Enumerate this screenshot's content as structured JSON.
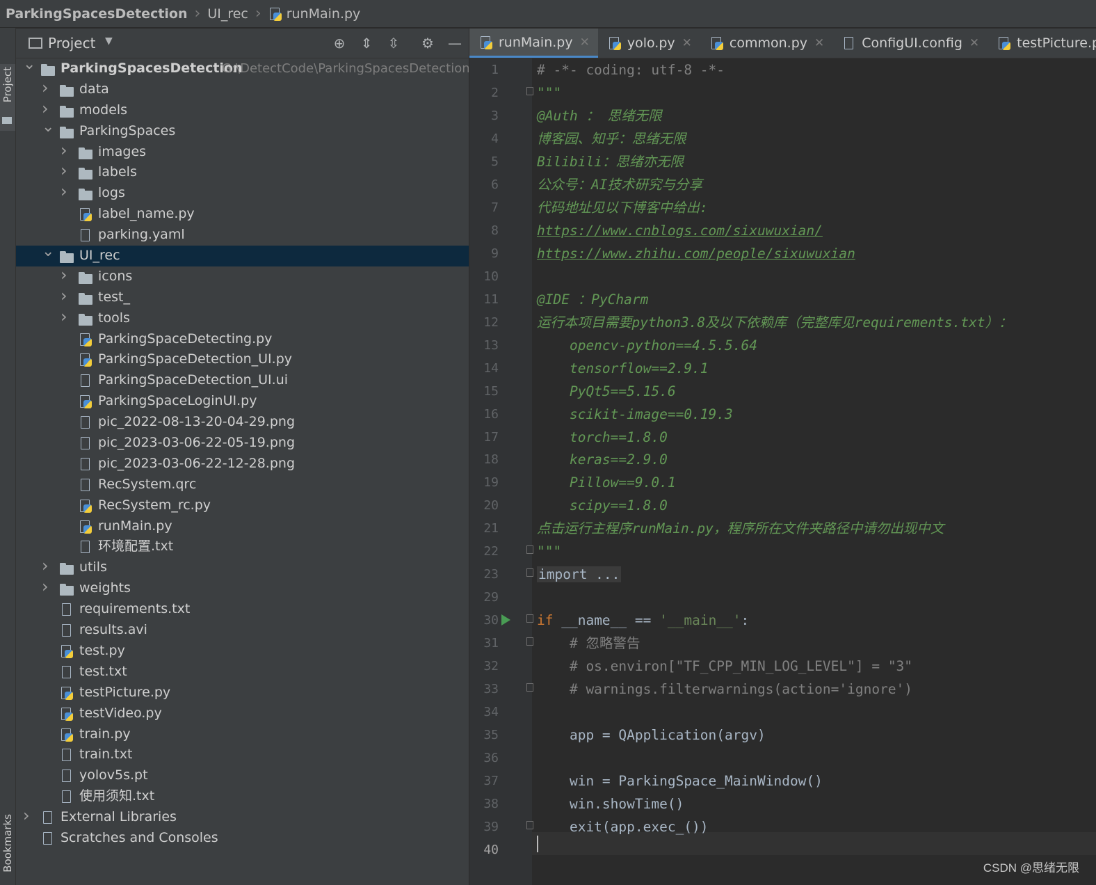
{
  "breadcrumb": [
    "ParkingSpacesDetection",
    "UI_rec",
    "runMain.py"
  ],
  "stripe": {
    "project_label": "Project",
    "bookmarks_label": "Bookmarks"
  },
  "project_panel": {
    "title": "Project",
    "root_path": "G:\\DetectCode\\ParkingSpacesDetection",
    "tree": [
      {
        "label": "ParkingSpacesDetection",
        "kind": "folder",
        "depth": 0,
        "expanded": true,
        "bold": true,
        "has_path": true
      },
      {
        "label": "data",
        "kind": "folder",
        "depth": 1,
        "expanded": false
      },
      {
        "label": "models",
        "kind": "folder",
        "depth": 1,
        "expanded": false
      },
      {
        "label": "ParkingSpaces",
        "kind": "folder",
        "depth": 1,
        "expanded": true
      },
      {
        "label": "images",
        "kind": "folder",
        "depth": 2,
        "expanded": false
      },
      {
        "label": "labels",
        "kind": "folder",
        "depth": 2,
        "expanded": false
      },
      {
        "label": "logs",
        "kind": "folder",
        "depth": 2,
        "expanded": false
      },
      {
        "label": "label_name.py",
        "kind": "py",
        "depth": 2
      },
      {
        "label": "parking.yaml",
        "kind": "yaml",
        "depth": 2
      },
      {
        "label": "UI_rec",
        "kind": "folder",
        "depth": 1,
        "expanded": true,
        "selected": true
      },
      {
        "label": "icons",
        "kind": "folder",
        "depth": 2,
        "expanded": false
      },
      {
        "label": "test_",
        "kind": "folder",
        "depth": 2,
        "expanded": false
      },
      {
        "label": "tools",
        "kind": "folder",
        "depth": 2,
        "expanded": false
      },
      {
        "label": "ParkingSpaceDetecting.py",
        "kind": "py",
        "depth": 2
      },
      {
        "label": "ParkingSpaceDetection_UI.py",
        "kind": "py",
        "depth": 2
      },
      {
        "label": "ParkingSpaceDetection_UI.ui",
        "kind": "ui",
        "depth": 2
      },
      {
        "label": "ParkingSpaceLoginUI.py",
        "kind": "py",
        "depth": 2
      },
      {
        "label": "pic_2022-08-13-20-04-29.png",
        "kind": "png",
        "depth": 2
      },
      {
        "label": "pic_2023-03-06-22-05-19.png",
        "kind": "png",
        "depth": 2
      },
      {
        "label": "pic_2023-03-06-22-12-28.png",
        "kind": "png",
        "depth": 2
      },
      {
        "label": "RecSystem.qrc",
        "kind": "qrc",
        "depth": 2
      },
      {
        "label": "RecSystem_rc.py",
        "kind": "py",
        "depth": 2
      },
      {
        "label": "runMain.py",
        "kind": "py",
        "depth": 2
      },
      {
        "label": "环境配置.txt",
        "kind": "txt",
        "depth": 2
      },
      {
        "label": "utils",
        "kind": "folder",
        "depth": 1,
        "expanded": false
      },
      {
        "label": "weights",
        "kind": "folder",
        "depth": 1,
        "expanded": false
      },
      {
        "label": "requirements.txt",
        "kind": "txt",
        "depth": 1
      },
      {
        "label": "results.avi",
        "kind": "unknown",
        "depth": 1
      },
      {
        "label": "test.py",
        "kind": "py",
        "depth": 1
      },
      {
        "label": "test.txt",
        "kind": "txt",
        "depth": 1
      },
      {
        "label": "testPicture.py",
        "kind": "py",
        "depth": 1
      },
      {
        "label": "testVideo.py",
        "kind": "py",
        "depth": 1
      },
      {
        "label": "train.py",
        "kind": "py",
        "depth": 1
      },
      {
        "label": "train.txt",
        "kind": "txt",
        "depth": 1
      },
      {
        "label": "yolov5s.pt",
        "kind": "unknown",
        "depth": 1
      },
      {
        "label": "使用须知.txt",
        "kind": "txt",
        "depth": 1
      },
      {
        "label": "External Libraries",
        "kind": "lib",
        "depth": 0,
        "expanded": false
      },
      {
        "label": "Scratches and Consoles",
        "kind": "scratch",
        "depth": 0
      }
    ]
  },
  "tabs": [
    {
      "label": "runMain.py",
      "kind": "py",
      "active": true
    },
    {
      "label": "yolo.py",
      "kind": "py"
    },
    {
      "label": "common.py",
      "kind": "py"
    },
    {
      "label": "ConfigUI.config",
      "kind": "txt"
    },
    {
      "label": "testPicture.py",
      "kind": "py"
    }
  ],
  "code_lines": [
    {
      "n": "1",
      "parts": [
        [
          "cm",
          "# -*- coding: utf-8 -*-"
        ]
      ]
    },
    {
      "n": "2",
      "fold": true,
      "parts": [
        [
          "doc",
          "\"\"\""
        ]
      ]
    },
    {
      "n": "3",
      "parts": [
        [
          "doc",
          "@Auth ： 思绪无限"
        ]
      ]
    },
    {
      "n": "4",
      "parts": [
        [
          "doc",
          "博客园、知乎：思绪无限"
        ]
      ]
    },
    {
      "n": "5",
      "parts": [
        [
          "doc",
          "Bilibili：思绪亦无限"
        ]
      ]
    },
    {
      "n": "6",
      "parts": [
        [
          "doc",
          "公众号：AI技术研究与分享"
        ]
      ]
    },
    {
      "n": "7",
      "parts": [
        [
          "doc",
          "代码地址见以下博客中给出:"
        ]
      ]
    },
    {
      "n": "8",
      "parts": [
        [
          "link",
          "https://www.cnblogs.com/sixuwuxian/"
        ]
      ]
    },
    {
      "n": "9",
      "parts": [
        [
          "link",
          "https://www.zhihu.com/people/sixuwuxian"
        ]
      ]
    },
    {
      "n": "10",
      "parts": []
    },
    {
      "n": "11",
      "parts": [
        [
          "doc",
          "@IDE ：PyCharm"
        ]
      ]
    },
    {
      "n": "12",
      "parts": [
        [
          "doc",
          "运行本项目需要python3.8及以下依赖库（完整库见requirements.txt）："
        ]
      ]
    },
    {
      "n": "13",
      "parts": [
        [
          "doc",
          "    opencv-python==4.5.5.64"
        ]
      ]
    },
    {
      "n": "14",
      "parts": [
        [
          "doc",
          "    tensorflow==2.9.1"
        ]
      ]
    },
    {
      "n": "15",
      "parts": [
        [
          "doc",
          "    PyQt5==5.15.6"
        ]
      ]
    },
    {
      "n": "16",
      "parts": [
        [
          "doc",
          "    scikit-image==0.19.3"
        ]
      ]
    },
    {
      "n": "17",
      "parts": [
        [
          "doc",
          "    torch==1.8.0"
        ]
      ]
    },
    {
      "n": "18",
      "parts": [
        [
          "doc",
          "    keras==2.9.0"
        ]
      ]
    },
    {
      "n": "19",
      "parts": [
        [
          "doc",
          "    Pillow==9.0.1"
        ]
      ]
    },
    {
      "n": "20",
      "parts": [
        [
          "doc",
          "    scipy==1.8.0"
        ]
      ]
    },
    {
      "n": "21",
      "parts": [
        [
          "doc",
          "点击运行主程序runMain.py，程序所在文件夹路径中请勿出现中文"
        ]
      ]
    },
    {
      "n": "22",
      "fold": true,
      "parts": [
        [
          "doc",
          "\"\"\""
        ]
      ]
    },
    {
      "n": "23",
      "fold": true,
      "parts": [
        [
          "fold-import",
          "import ..."
        ]
      ]
    },
    {
      "n": "29",
      "parts": []
    },
    {
      "n": "30",
      "run": true,
      "fold": true,
      "parts": [
        [
          "kw",
          "if "
        ],
        [
          "plain",
          "__name__ == "
        ],
        [
          "str",
          "'__main__'"
        ],
        [
          "plain",
          ":"
        ]
      ]
    },
    {
      "n": "31",
      "fold": true,
      "parts": [
        [
          "cm",
          "    # 忽略警告"
        ]
      ]
    },
    {
      "n": "32",
      "parts": [
        [
          "cm",
          "    # os.environ[\"TF_CPP_MIN_LOG_LEVEL\"] = \"3\""
        ]
      ]
    },
    {
      "n": "33",
      "fold": true,
      "parts": [
        [
          "cm",
          "    # warnings.filterwarnings(action='ignore')"
        ]
      ]
    },
    {
      "n": "34",
      "parts": []
    },
    {
      "n": "35",
      "parts": [
        [
          "plain",
          "    app = QApplication(argv)"
        ]
      ]
    },
    {
      "n": "36",
      "parts": []
    },
    {
      "n": "37",
      "parts": [
        [
          "plain",
          "    win = ParkingSpace_MainWindow()"
        ]
      ]
    },
    {
      "n": "38",
      "parts": [
        [
          "plain",
          "    win.showTime()"
        ]
      ]
    },
    {
      "n": "39",
      "fold": true,
      "parts": [
        [
          "plain",
          "    exit(app.exec_())"
        ]
      ]
    },
    {
      "n": "40",
      "current": true,
      "parts": []
    }
  ],
  "watermark": "CSDN @思绪无限",
  "colors": {
    "accent": "#4a88c7",
    "selection": "#0d293e",
    "doc": "#629755",
    "keyword": "#cc7832",
    "string": "#6a8759"
  }
}
